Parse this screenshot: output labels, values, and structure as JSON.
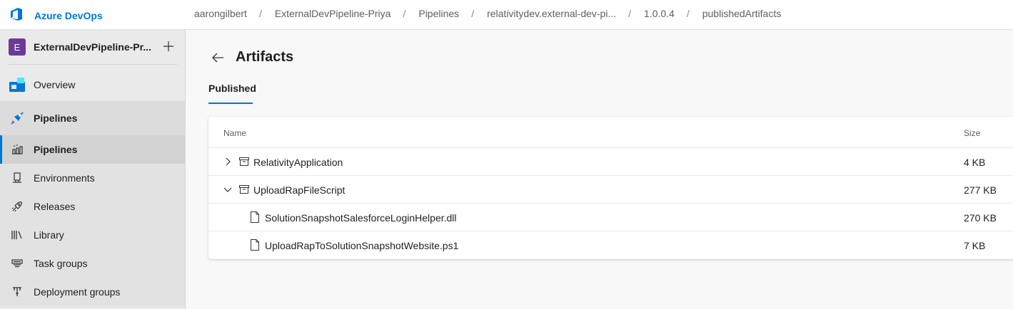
{
  "app": {
    "brand": "Azure DevOps"
  },
  "breadcrumb": [
    "aarongilbert",
    "ExternalDevPipeline-Priya",
    "Pipelines",
    "relativitydev.external-dev-pi...",
    "1.0.0.4",
    "publishedArtifacts"
  ],
  "breadcrumb_separator": "/",
  "project": {
    "initial": "E",
    "name": "ExternalDevPipeline-Pr...",
    "color": "#6b3a98"
  },
  "sidebar": {
    "overview": "Overview",
    "section": "Pipelines",
    "items": [
      {
        "label": "Pipelines",
        "icon": "pipelines-icon",
        "active": true
      },
      {
        "label": "Environments",
        "icon": "environments-icon"
      },
      {
        "label": "Releases",
        "icon": "releases-icon"
      },
      {
        "label": "Library",
        "icon": "library-icon"
      },
      {
        "label": "Task groups",
        "icon": "task-groups-icon"
      },
      {
        "label": "Deployment groups",
        "icon": "deployment-groups-icon"
      }
    ]
  },
  "main": {
    "title": "Artifacts",
    "tab": "Published",
    "table": {
      "columns": [
        "Name",
        "Size"
      ],
      "rows": [
        {
          "name": "RelativityApplication",
          "size": "4 KB",
          "type": "artifact",
          "expanded": false
        },
        {
          "name": "UploadRapFileScript",
          "size": "277 KB",
          "type": "artifact",
          "expanded": true
        },
        {
          "name": "SolutionSnapshotSalesforceLoginHelper.dll",
          "size": "270 KB",
          "type": "file"
        },
        {
          "name": "UploadRapToSolutionSnapshotWebsite.ps1",
          "size": "7 KB",
          "type": "file"
        }
      ]
    }
  },
  "colors": {
    "accent": "#0078d4",
    "sidebar_bg": "#eaeaea"
  }
}
